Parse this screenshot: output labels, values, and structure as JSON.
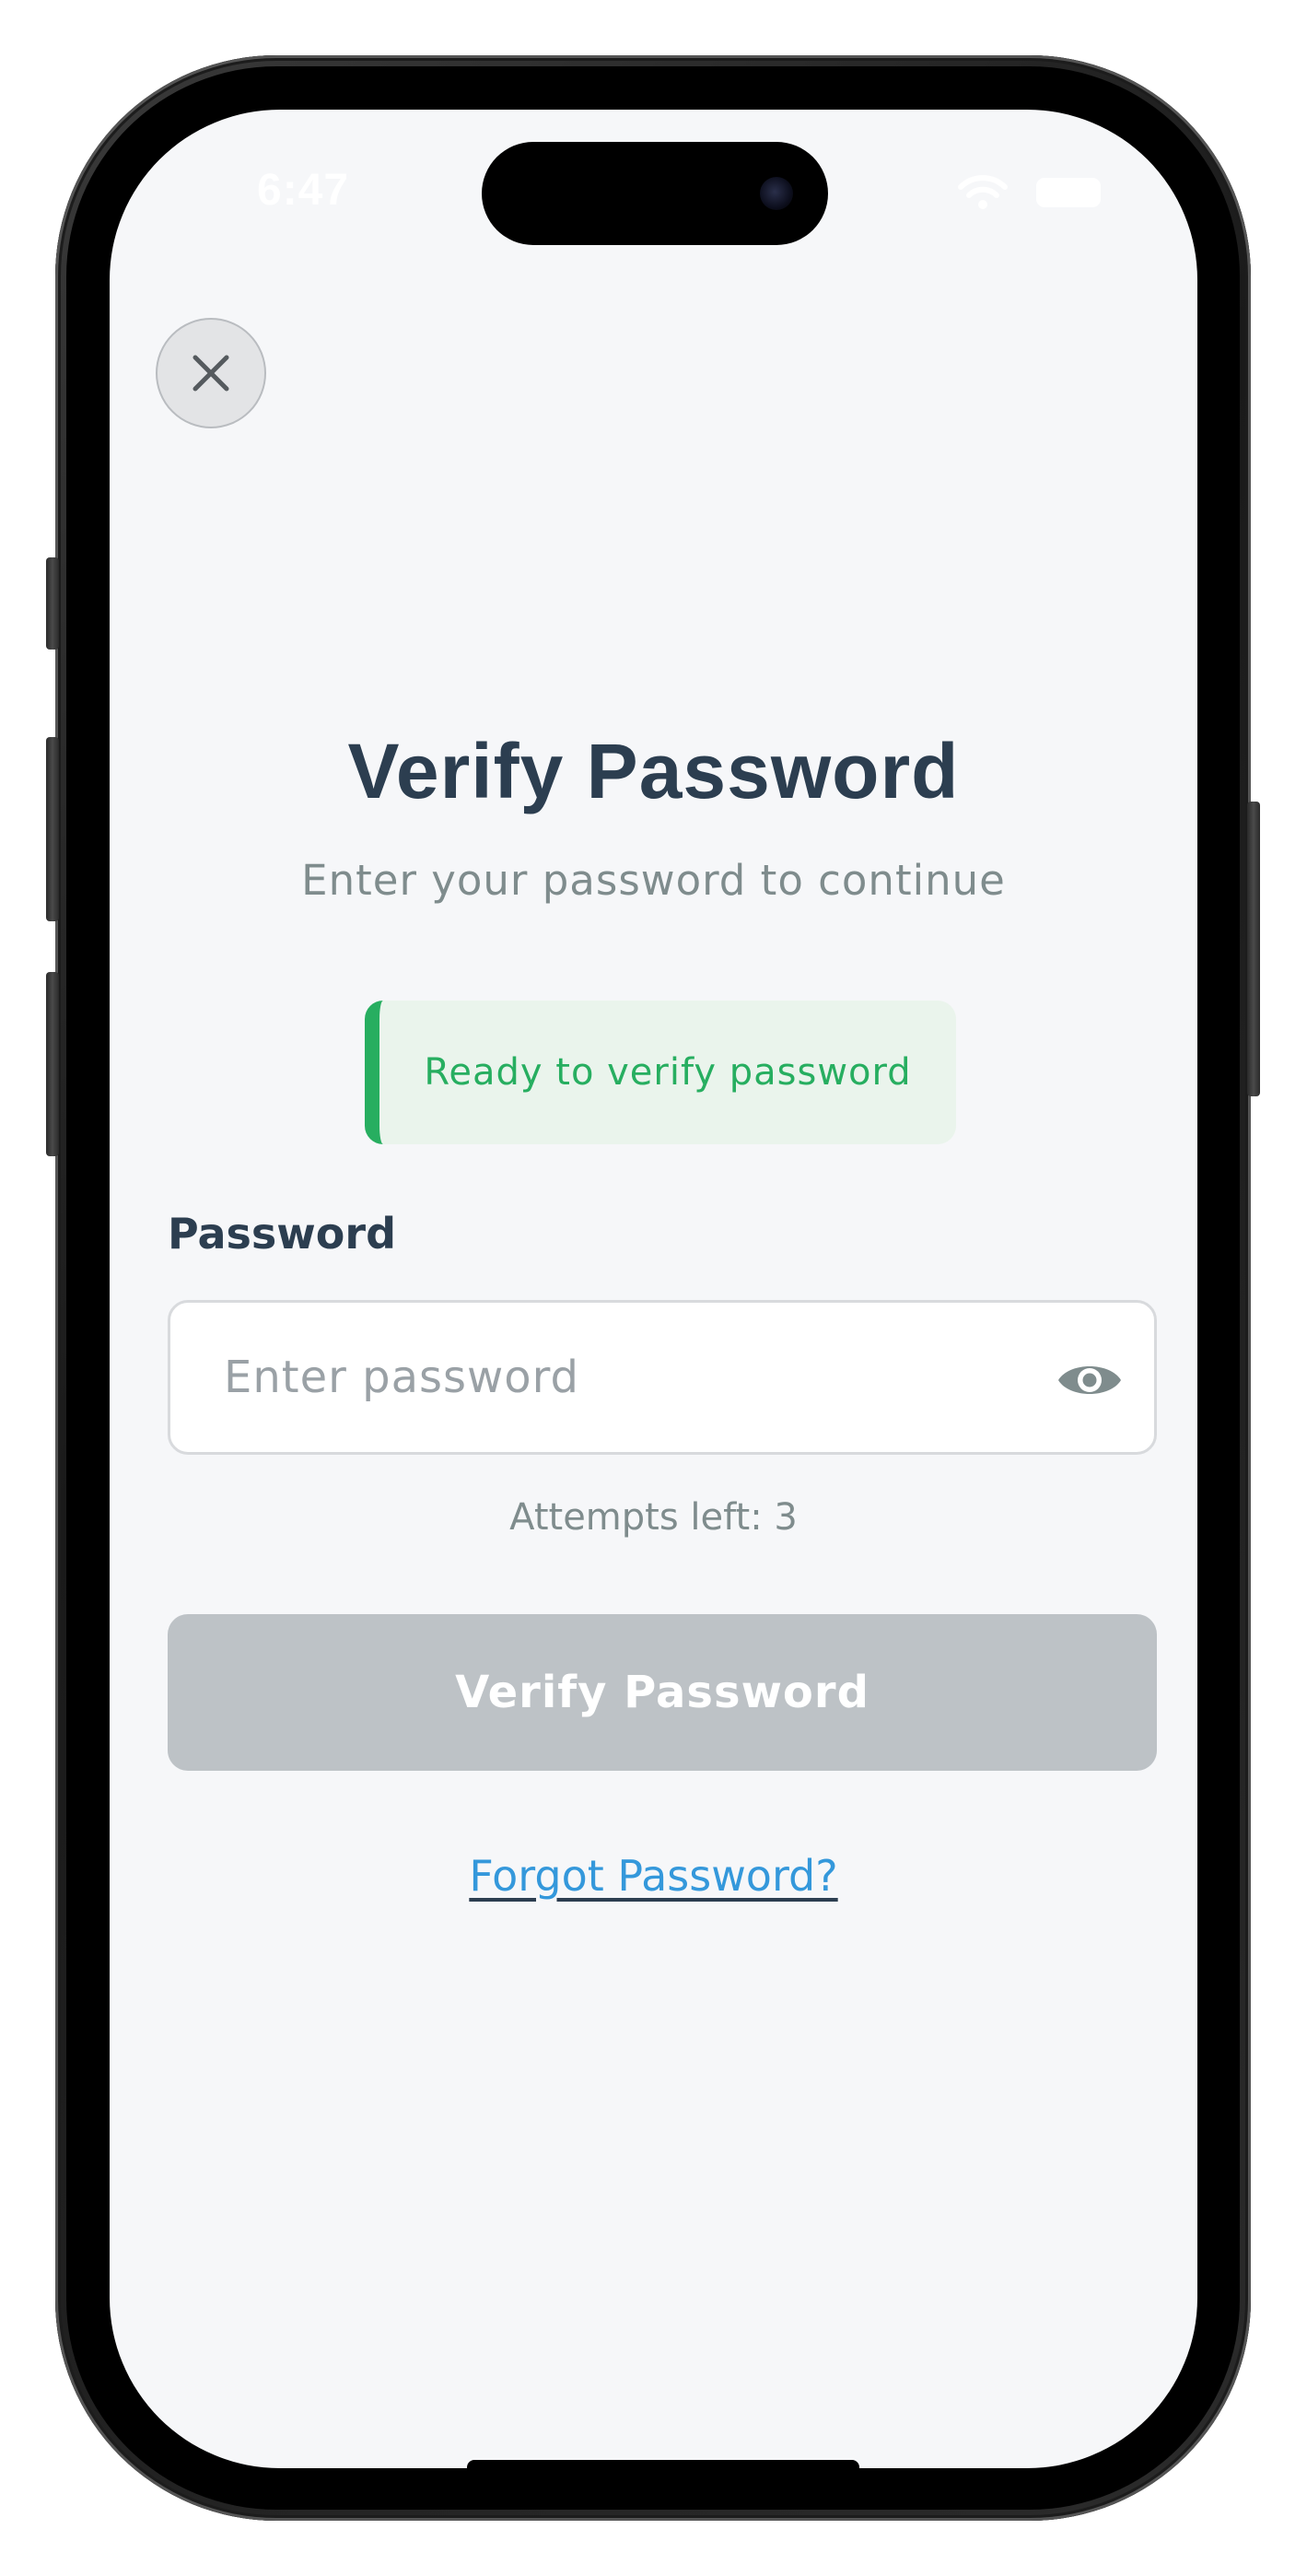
{
  "status_bar": {
    "time": "6:47"
  },
  "header": {
    "close_icon": "close-icon"
  },
  "main": {
    "title": "Verify Password",
    "subtitle": "Enter your password to continue",
    "status_banner": {
      "text": "Ready to verify password",
      "accent_color": "#27ae60"
    },
    "password_field": {
      "label": "Password",
      "value": "",
      "placeholder": "Enter password",
      "toggle_icon": "eye-icon"
    },
    "attempts_text": "Attempts left: 3",
    "verify_button_label": "Verify Password",
    "forgot_link_label": "Forgot Password?"
  },
  "colors": {
    "title": "#2c3e50",
    "muted": "#7f8c8d",
    "success": "#27ae60",
    "link": "#3498db",
    "button_disabled": "#bdc2c6",
    "screen_bg": "#f6f7f9"
  }
}
